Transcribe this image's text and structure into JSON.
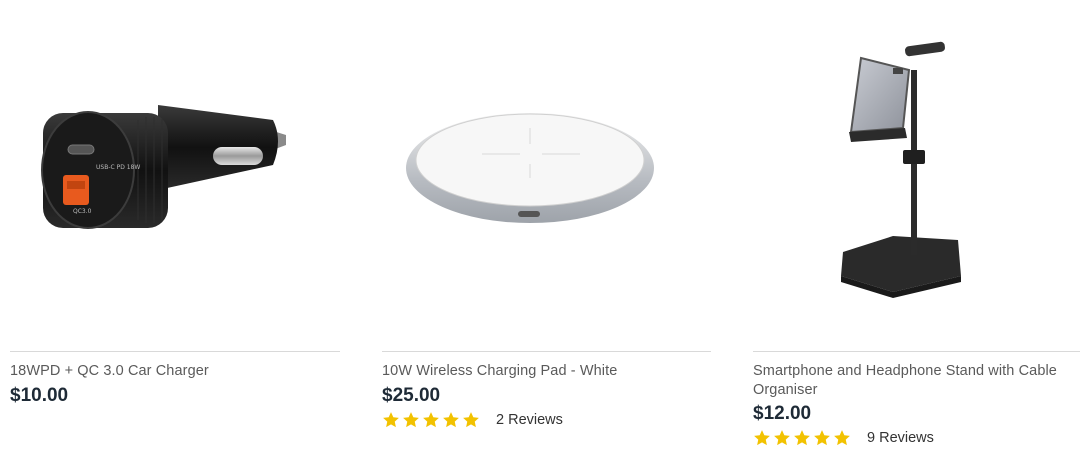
{
  "products": [
    {
      "title": "18WPD + QC 3.0 Car Charger",
      "price": "$10.00",
      "image_icon": "car-charger-image"
    },
    {
      "title": "10W Wireless Charging Pad - White",
      "price": "$25.00",
      "rating": 5,
      "reviews": "2 Reviews",
      "image_icon": "wireless-charging-pad-image"
    },
    {
      "title": "Smartphone and Headphone Stand with Cable Organiser",
      "price": "$12.00",
      "rating": 5,
      "reviews": "9 Reviews",
      "image_icon": "phone-stand-image"
    }
  ],
  "colors": {
    "star": "#f2c200",
    "price": "#1e2a36",
    "title": "#5a5a5a",
    "divider": "#d9d9d9"
  }
}
